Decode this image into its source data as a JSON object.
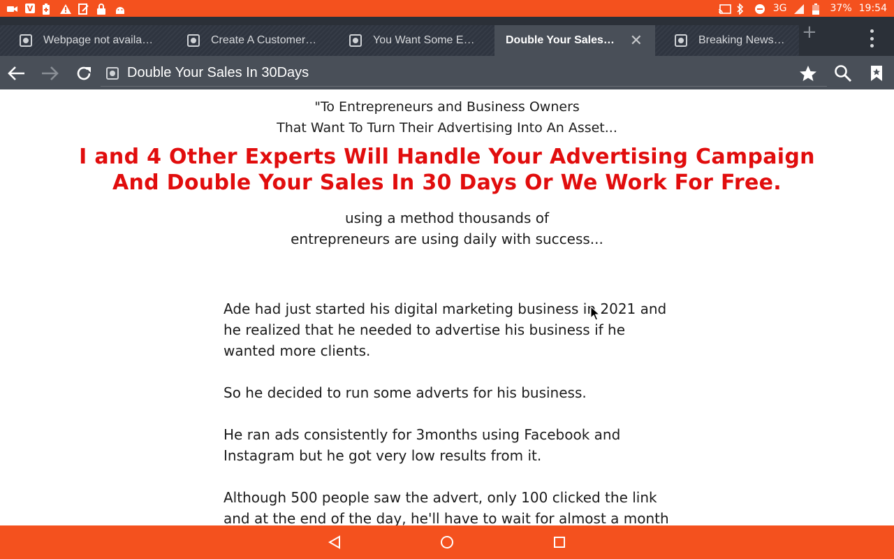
{
  "status_bar": {
    "network": "3G",
    "battery": "37%",
    "time": "19:54",
    "left_icons": [
      "video-icon",
      "vivaldi-icon",
      "battery-saver-icon",
      "warning-icon",
      "edit-icon",
      "lock-icon",
      "android-icon"
    ],
    "right_icons": [
      "cast-icon",
      "bluetooth-icon",
      "dnd-icon",
      "signal-icon",
      "battery-icon"
    ]
  },
  "tabs": [
    {
      "label": "Webpage not availa…",
      "active": false
    },
    {
      "label": "Create A Customer…",
      "active": false
    },
    {
      "label": "You Want Some Em…",
      "active": false
    },
    {
      "label": "Double Your Sales I…",
      "active": true
    },
    {
      "label": "Breaking News!! for",
      "active": false
    }
  ],
  "toolbar": {
    "url_title": "Double Your Sales In 30Days"
  },
  "page": {
    "intro_line1": "\"To Entrepreneurs and Business Owners",
    "intro_line2": "That Want To Turn Their Advertising Into An Asset...",
    "headline_line1": "I and 4 Other Experts Will Handle Your Advertising Campaign",
    "headline_line2": "And Double Your Sales In 30 Days Or We Work For Free.",
    "sub_line1": "using a method thousands of",
    "sub_line2": "entrepreneurs are using daily with success...",
    "paragraphs": [
      "Ade had just started his digital marketing business in 2021 and he realized that he needed to advertise his business if he wanted more clients.",
      "So he decided to run some adverts for his business.",
      "He ran ads consistently for 3months using Facebook and Instagram but he got very low results from it.",
      "Although 500 people saw the advert, only 100 clicked the link and at the end of the day, he'll have to wait for almost a month"
    ]
  },
  "colors": {
    "accent": "#f4511e",
    "headline": "#e10d0d",
    "tab_bg": "#2b3038",
    "toolbar_bg": "#494f58"
  }
}
